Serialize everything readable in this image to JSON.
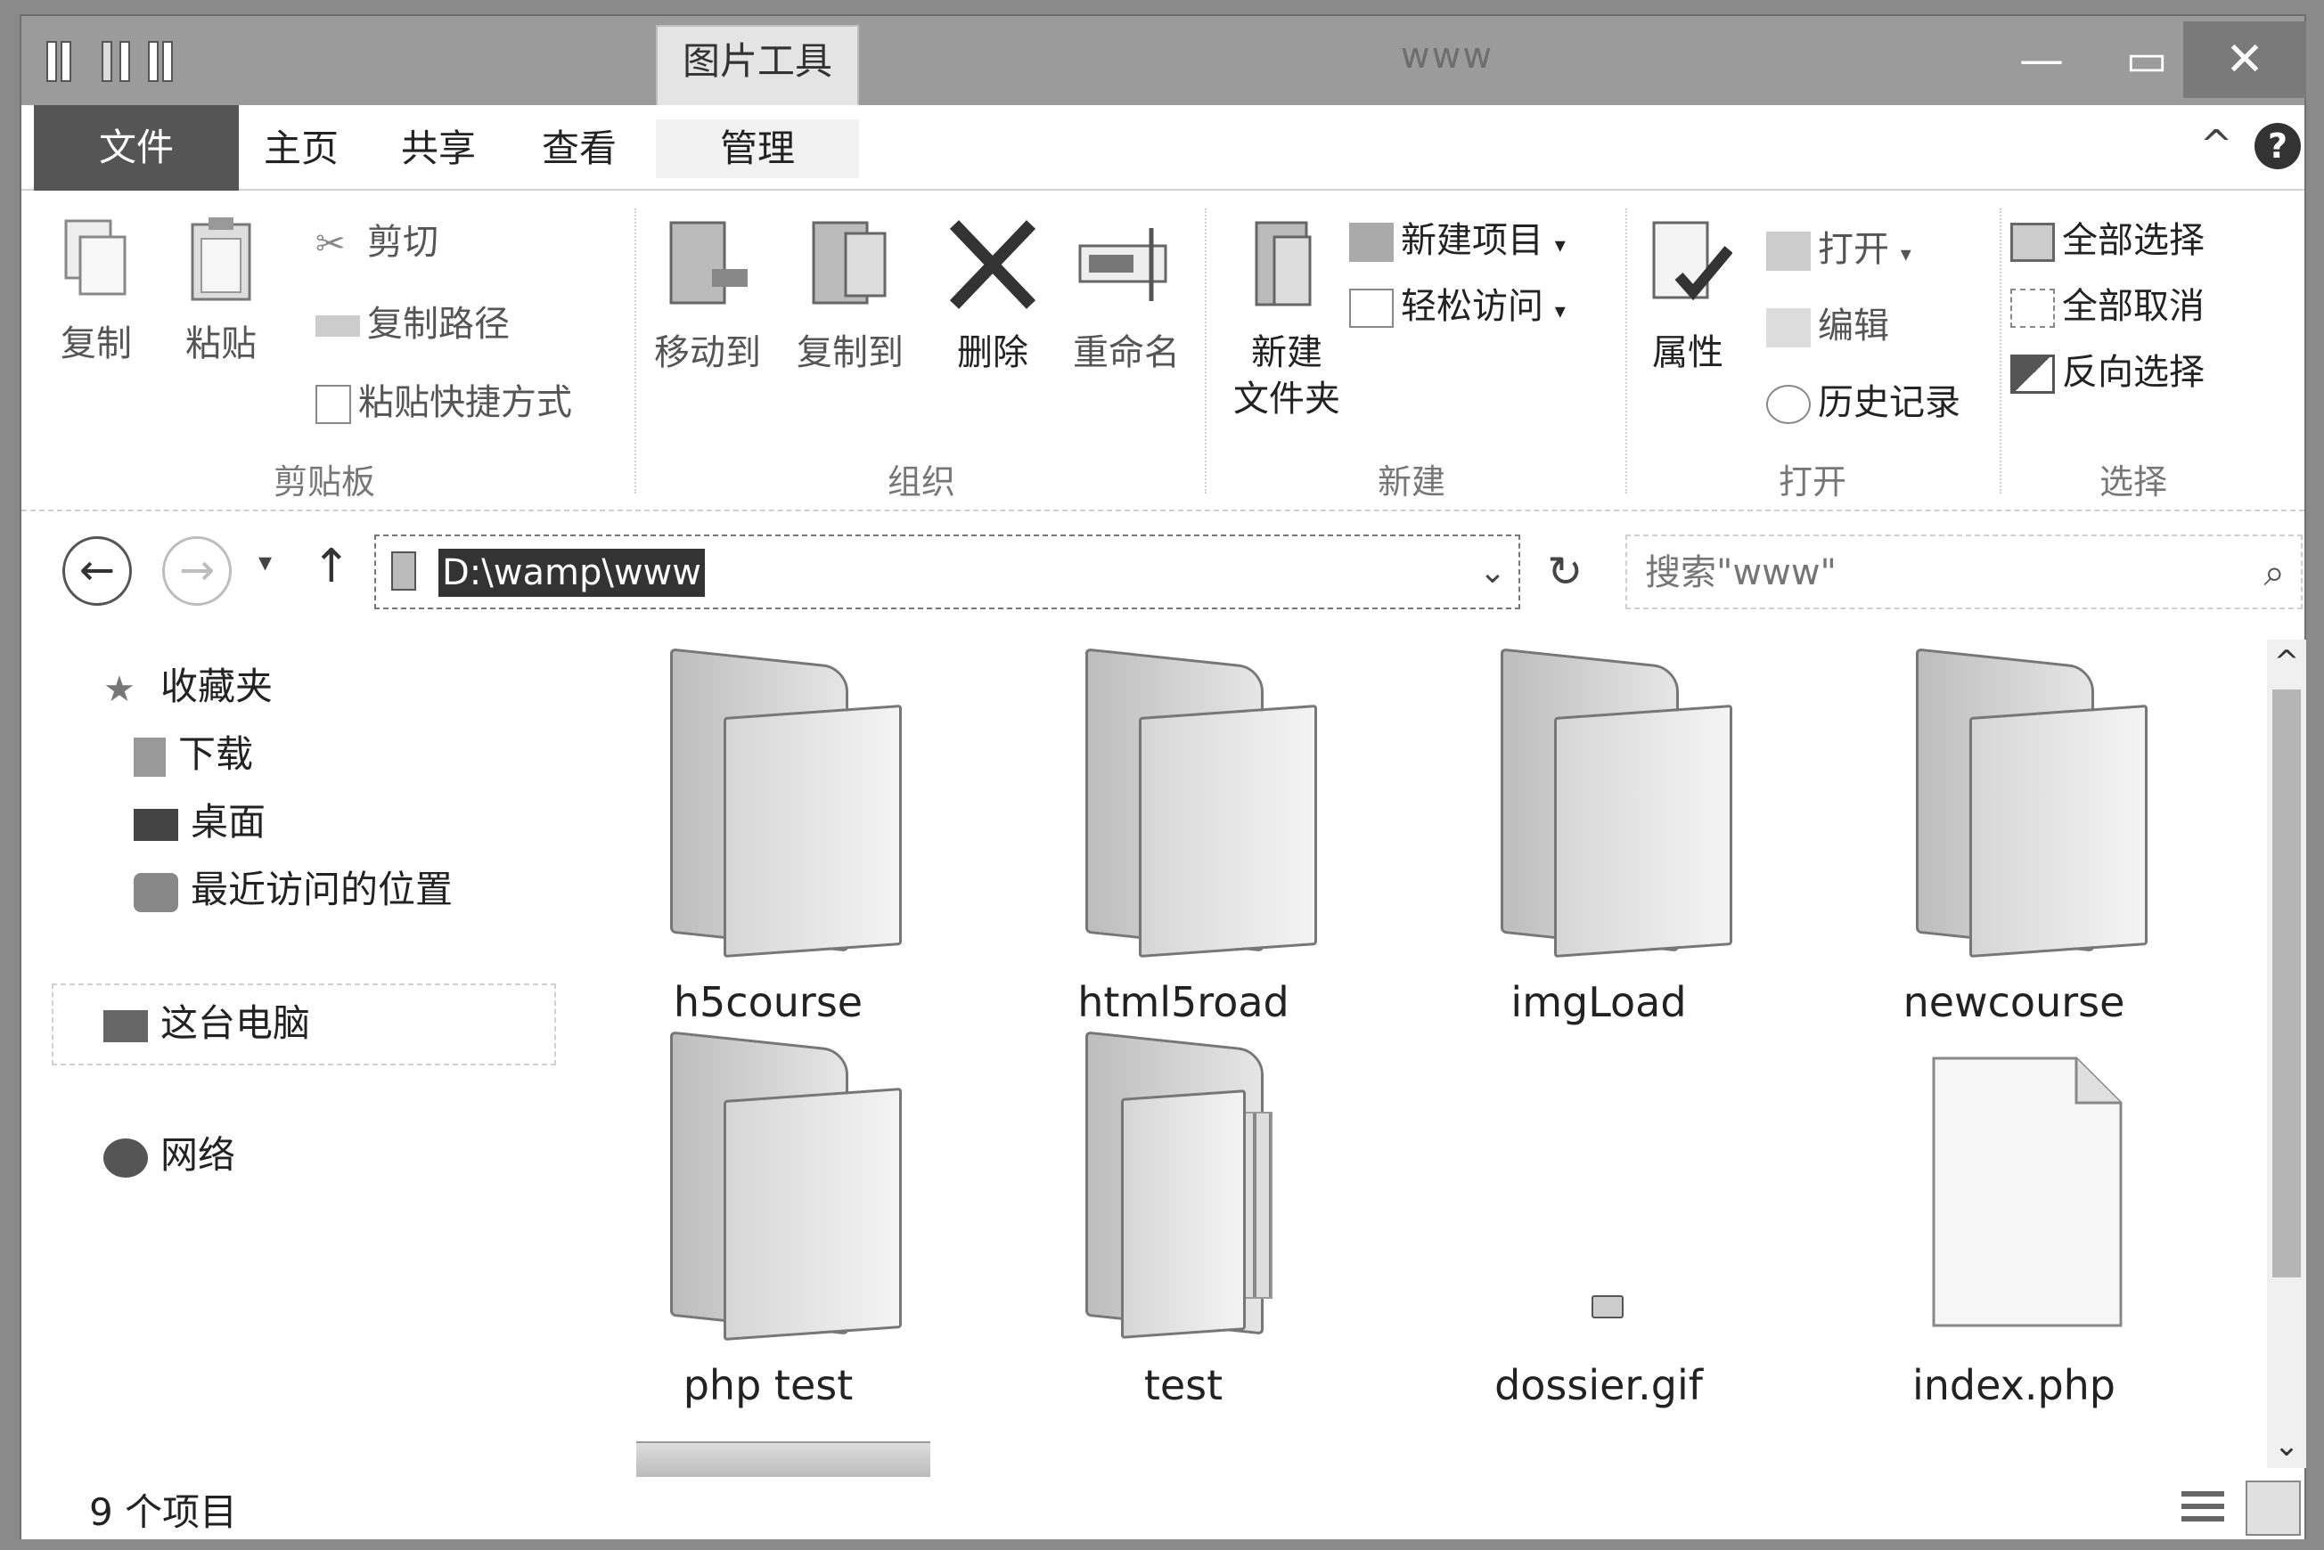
{
  "titlebar": {
    "contextual_tab": "图片工具",
    "window_title": "www",
    "minimize": "—",
    "maximize": "▭",
    "close": "✕"
  },
  "tabs": {
    "file": "文件",
    "home": "主页",
    "share": "共享",
    "view": "查看",
    "manage": "管理",
    "collapse": "^",
    "help": "?"
  },
  "ribbon": {
    "clipboard": {
      "label": "剪贴板",
      "copy": "复制",
      "paste": "粘贴",
      "cut": "剪切",
      "copy_path": "复制路径",
      "paste_shortcut": "粘贴快捷方式"
    },
    "organize": {
      "label": "组织",
      "move_to": "移动到",
      "copy_to": "复制到",
      "delete": "删除",
      "rename": "重命名"
    },
    "new": {
      "label": "新建",
      "new_folder_line1": "新建",
      "new_folder_line2": "文件夹",
      "new_item": "新建项目",
      "easy_access": "轻松访问"
    },
    "open": {
      "label": "打开",
      "properties": "属性",
      "open": "打开",
      "edit": "编辑",
      "history": "历史记录"
    },
    "select": {
      "label": "选择",
      "select_all": "全部选择",
      "select_none": "全部取消",
      "invert": "反向选择"
    }
  },
  "navbar": {
    "address": "D:\\wamp\\www",
    "search_placeholder": "搜索\"www\""
  },
  "navpane": {
    "favorites": "收藏夹",
    "downloads": "下载",
    "desktop": "桌面",
    "recent": "最近访问的位置",
    "this_pc": "这台电脑",
    "network": "网络"
  },
  "items": [
    {
      "name": "h5course",
      "type": "folder"
    },
    {
      "name": "html5road",
      "type": "folder"
    },
    {
      "name": "imgLoad",
      "type": "folder"
    },
    {
      "name": "newcourse",
      "type": "folder"
    },
    {
      "name": "php test",
      "type": "folder"
    },
    {
      "name": "test",
      "type": "folder"
    },
    {
      "name": "dossier.gif",
      "type": "image"
    },
    {
      "name": "index.php",
      "type": "file"
    }
  ],
  "status": {
    "count": "9 个项目"
  },
  "colors": {
    "titlebar": "#9b9b9b",
    "file_tab": "#555555",
    "background": "#ffffff"
  }
}
